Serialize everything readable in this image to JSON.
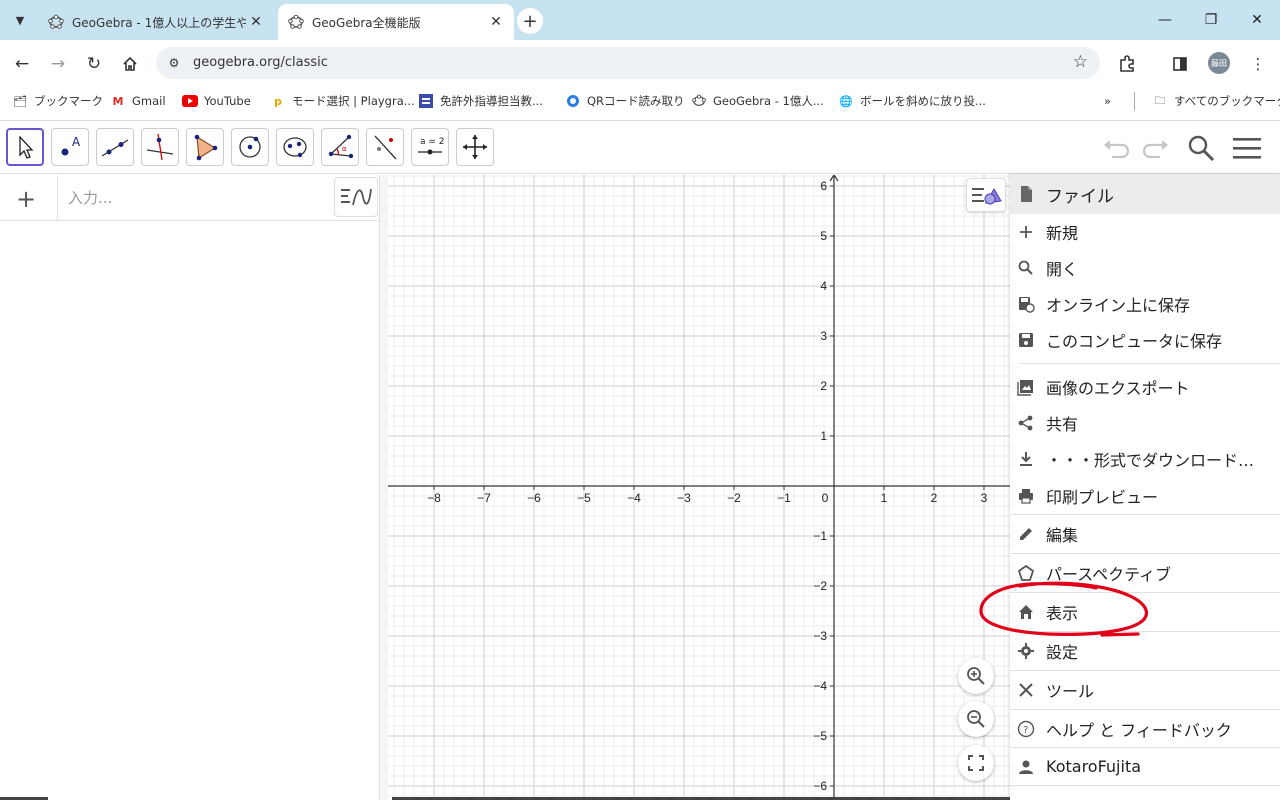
{
  "browser": {
    "tabs": [
      {
        "title": "GeoGebra - 1億人以上の学生や",
        "active": false
      },
      {
        "title": "GeoGebra全機能版",
        "active": true
      }
    ],
    "url": "geogebra.org/classic",
    "avatar_text": "藤田",
    "bookmarks": [
      {
        "label": "ブックマーク",
        "icon": "bookmark-folder-icon"
      },
      {
        "label": "Gmail",
        "icon": "gmail-icon"
      },
      {
        "label": "YouTube",
        "icon": "youtube-icon"
      },
      {
        "label": "モード選択 | Playgra...",
        "icon": "playground-icon"
      },
      {
        "label": "免許外指導担当教...",
        "icon": "forms-icon"
      },
      {
        "label": "QRコード読み取り",
        "icon": "qr-icon"
      },
      {
        "label": "GeoGebra - 1億人...",
        "icon": "geogebra-icon"
      },
      {
        "label": "ボールを斜めに放り投...",
        "icon": "globe-icon"
      }
    ],
    "all_bookmarks": "すべてのブックマーク"
  },
  "algebra": {
    "input_placeholder": "入力..."
  },
  "graph": {
    "x_ticks": [
      "−8",
      "−7",
      "−6",
      "−5",
      "−4",
      "−3",
      "−2",
      "−1",
      "0",
      "1",
      "2",
      "3"
    ],
    "y_ticks": [
      "6",
      "5",
      "4",
      "3",
      "2",
      "1",
      "−1",
      "−2",
      "−3",
      "−4",
      "−5",
      "−6"
    ]
  },
  "menu": {
    "items": [
      {
        "label": "ファイル",
        "icon": "file-icon"
      },
      {
        "label": "新規",
        "icon": "plus-icon"
      },
      {
        "label": "開く",
        "icon": "search-icon"
      },
      {
        "label": "オンライン上に保存",
        "icon": "cloud-save-icon"
      },
      {
        "label": "このコンピュータに保存",
        "icon": "save-icon"
      },
      {
        "label": "画像のエクスポート",
        "icon": "image-icon"
      },
      {
        "label": "共有",
        "icon": "share-icon"
      },
      {
        "label": "・・・形式でダウンロード…",
        "icon": "download-icon"
      },
      {
        "label": "印刷プレビュー",
        "icon": "print-icon"
      },
      {
        "label": "編集",
        "icon": "pencil-icon"
      },
      {
        "label": "パースペクティブ",
        "icon": "perspective-icon"
      },
      {
        "label": "表示",
        "icon": "home-icon"
      },
      {
        "label": "設定",
        "icon": "gear-icon"
      },
      {
        "label": "ツール",
        "icon": "tools-icon"
      },
      {
        "label": "ヘルプ と フィードバック",
        "icon": "help-icon"
      },
      {
        "label": "KotaroFujita",
        "icon": "person-icon"
      }
    ]
  },
  "colors": {
    "accent": "#6557d2",
    "tab_strip": "#c7e3f2",
    "annotation": "#e0001a"
  }
}
